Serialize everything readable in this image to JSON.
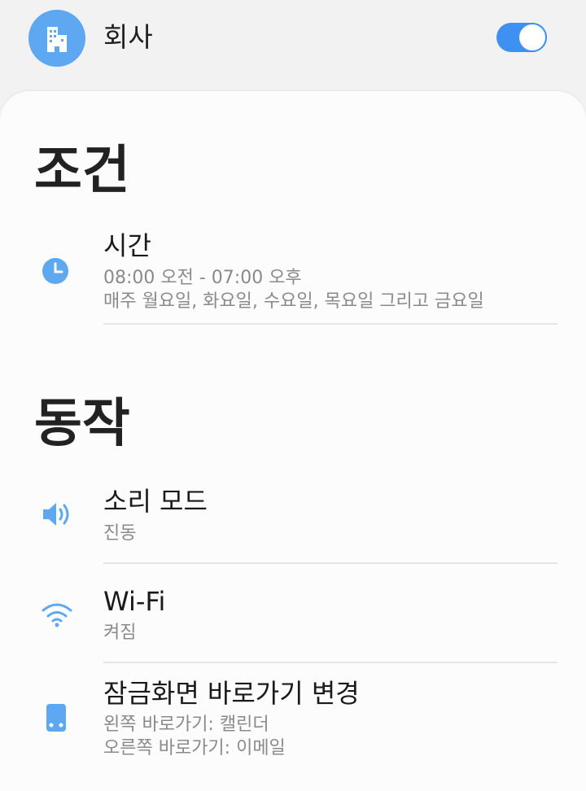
{
  "header": {
    "mode_name": "회사",
    "toggle_on": true,
    "icon": "building-icon"
  },
  "conditions": {
    "title": "조건",
    "items": [
      {
        "icon": "clock-icon",
        "title": "시간",
        "line1": "08:00 오전 - 07:00 오후",
        "line2": "매주 월요일, 화요일, 수요일, 목요일 그리고 금요일"
      }
    ]
  },
  "actions": {
    "title": "동작",
    "items": [
      {
        "icon": "speaker-icon",
        "title": "소리 모드",
        "line1": "진동"
      },
      {
        "icon": "wifi-icon",
        "title": "Wi-Fi",
        "line1": "켜짐"
      },
      {
        "icon": "phone-icon",
        "title": "잠금화면 바로가기 변경",
        "line1": "왼쪽 바로가기: 캘린더",
        "line2": "오른쪽 바로가기: 이메일"
      }
    ]
  },
  "colors": {
    "accent": "#3e91f0",
    "icon_blue": "#5ea8f1"
  }
}
